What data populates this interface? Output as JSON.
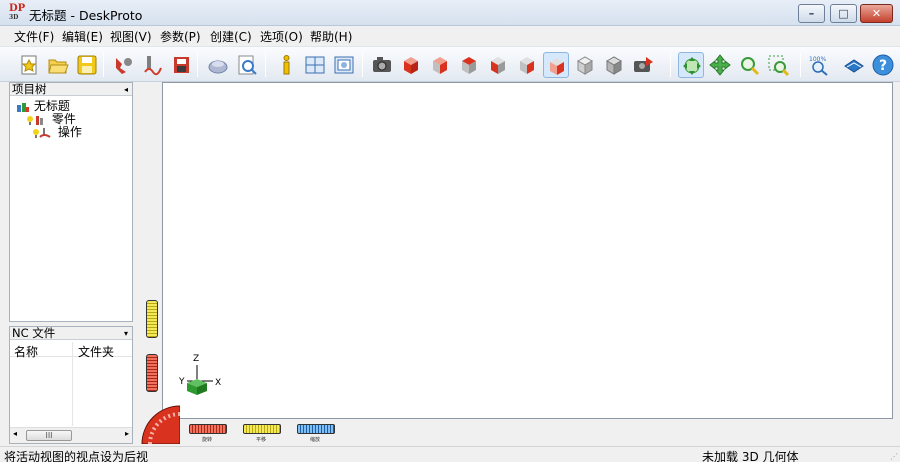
{
  "window": {
    "title": "无标题 - DeskProto",
    "logo_text_top": "DP",
    "logo_text_bottom": "3D"
  },
  "window_controls": {
    "minimize": "–",
    "maximize": "□",
    "close": "✕"
  },
  "menu": [
    {
      "label": "文件(F)"
    },
    {
      "label": "编辑(E)"
    },
    {
      "label": "视图(V)"
    },
    {
      "label": "参数(P)"
    },
    {
      "label": "创建(C)"
    },
    {
      "label": "选项(O)"
    },
    {
      "label": "帮助(H)"
    }
  ],
  "toolbar": {
    "buttons": [
      {
        "icon": "new-project-icon"
      },
      {
        "icon": "open-folder-icon"
      },
      {
        "icon": "save-icon"
      },
      {
        "icon": "import-part-icon"
      },
      {
        "icon": "toolpath-icon"
      },
      {
        "icon": "write-nc-icon"
      },
      {
        "icon": "simulate-icon"
      },
      {
        "icon": "preview-icon"
      },
      {
        "icon": "info-icon"
      },
      {
        "icon": "layout-icon"
      },
      {
        "icon": "screen-view-icon"
      },
      {
        "icon": "camera-icon"
      },
      {
        "icon": "view-front-icon"
      },
      {
        "icon": "view-right-icon"
      },
      {
        "icon": "view-top-icon"
      },
      {
        "icon": "view-left-icon"
      },
      {
        "icon": "view-bottom-icon"
      },
      {
        "icon": "view-back-icon"
      },
      {
        "icon": "view-iso-icon"
      },
      {
        "icon": "view-iso2-icon"
      },
      {
        "icon": "camera-rotate-icon"
      },
      {
        "icon": "rotate-mode-icon"
      },
      {
        "icon": "pan-mode-icon"
      },
      {
        "icon": "zoom-mode-icon"
      },
      {
        "icon": "zoom-window-icon"
      },
      {
        "icon": "zoom-100-icon"
      },
      {
        "icon": "manual-icon"
      },
      {
        "icon": "help-icon"
      }
    ],
    "zoom_100_label": "100%"
  },
  "project_tree": {
    "header": "项目树",
    "collapse_glyph": "◂",
    "root": "无标题",
    "items": [
      {
        "label": "零件"
      },
      {
        "label": "操作"
      }
    ]
  },
  "nc_panel": {
    "header": "NC 文件",
    "dropdown_glyph": "▾",
    "columns": [
      "名称",
      "文件夹"
    ],
    "scroll_thumb": "III",
    "scroll_left": "◂",
    "scroll_right": "▸"
  },
  "viewport": {
    "axis_z": "Z",
    "axis_y": "Y",
    "axis_x": "X"
  },
  "bottom_dials": {
    "labels": [
      "旋转",
      "平移",
      "缩放"
    ]
  },
  "status": {
    "left": "将活动视图的视点设为后视",
    "right": "未加载 3D 几何体"
  },
  "colors": {
    "accent_red": "#d9321f",
    "accent_yellow": "#e6d51a",
    "accent_blue": "#3c8ee0",
    "axis_green": "#2f9a2f"
  }
}
